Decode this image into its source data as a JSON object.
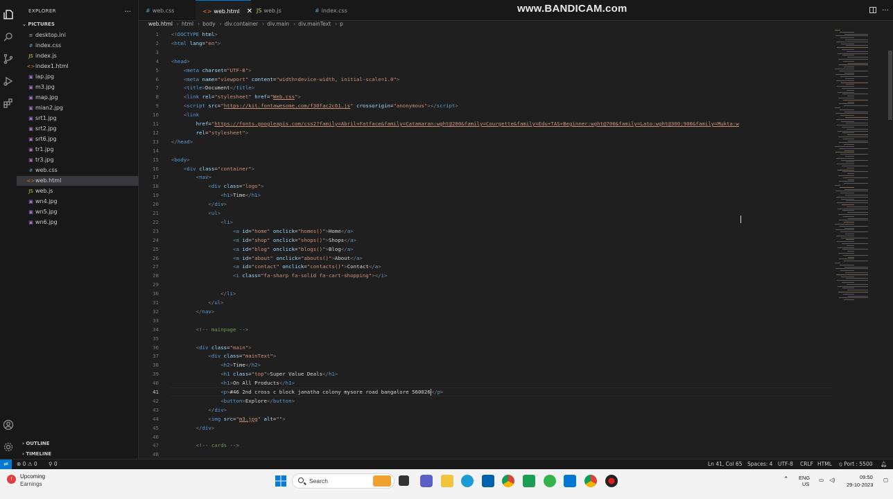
{
  "watermark": "www.BANDICAM.com",
  "sidebar": {
    "title": "EXPLORER",
    "more": "...",
    "folder": "PICTURES",
    "files": [
      {
        "name": "desktop.ini",
        "icon": "≡",
        "color": "#a0a0a0"
      },
      {
        "name": "index.css",
        "icon": "#",
        "color": "#519aba"
      },
      {
        "name": "index.js",
        "icon": "JS",
        "color": "#cbcb41"
      },
      {
        "name": "index1.html",
        "icon": "<>",
        "color": "#e37933"
      },
      {
        "name": "lap.jpg",
        "icon": "▣",
        "color": "#a074c4"
      },
      {
        "name": "m3.jpg",
        "icon": "▣",
        "color": "#a074c4"
      },
      {
        "name": "map.jpg",
        "icon": "▣",
        "color": "#a074c4"
      },
      {
        "name": "mian2.jpg",
        "icon": "▣",
        "color": "#a074c4"
      },
      {
        "name": "srt1.jpg",
        "icon": "▣",
        "color": "#a074c4"
      },
      {
        "name": "srt2.jpg",
        "icon": "▣",
        "color": "#a074c4"
      },
      {
        "name": "srt6.jpg",
        "icon": "▣",
        "color": "#a074c4"
      },
      {
        "name": "tr1.jpg",
        "icon": "▣",
        "color": "#a074c4"
      },
      {
        "name": "tr3.jpg",
        "icon": "▣",
        "color": "#a074c4"
      },
      {
        "name": "web.css",
        "icon": "#",
        "color": "#519aba"
      },
      {
        "name": "web.html",
        "icon": "<>",
        "color": "#e37933",
        "selected": true
      },
      {
        "name": "web.js",
        "icon": "JS",
        "color": "#cbcb41"
      },
      {
        "name": "wn4.jpg",
        "icon": "▣",
        "color": "#a074c4"
      },
      {
        "name": "wn5.jpg",
        "icon": "▣",
        "color": "#a074c4"
      },
      {
        "name": "wn6.jpg",
        "icon": "▣",
        "color": "#a074c4"
      }
    ],
    "outline": "OUTLINE",
    "timeline": "TIMELINE"
  },
  "tabs": [
    {
      "label": "web.css",
      "icon": "#",
      "color": "#519aba"
    },
    {
      "label": "web.html",
      "icon": "<>",
      "color": "#e37933",
      "active": true,
      "close": "✕"
    },
    {
      "label": "web.js",
      "icon": "JS",
      "color": "#cbcb41"
    },
    {
      "label": "index.css",
      "icon": "#",
      "color": "#519aba"
    },
    {
      "label": "index.css",
      "icon": "#",
      "color": "#519aba"
    }
  ],
  "breadcrumb": [
    "web.html",
    "html",
    "body",
    "div.container",
    "div.main",
    "div.mainText",
    "p"
  ],
  "code": [
    {
      "n": 1,
      "h": "<span class='t'>&lt;!</span><span class='tn'>DOCTYPE</span> <span class='at'>html</span><span class='t'>&gt;</span>"
    },
    {
      "n": 2,
      "h": "<span class='t'>&lt;</span><span class='tn'>html</span> <span class='at'>lang</span>=<span class='sv'>\"en\"</span><span class='t'>&gt;</span>"
    },
    {
      "n": 3,
      "h": ""
    },
    {
      "n": 4,
      "h": "<span class='t'>&lt;</span><span class='tn'>head</span><span class='t'>&gt;</span>"
    },
    {
      "n": 5,
      "h": "    <span class='t'>&lt;</span><span class='tn'>meta</span> <span class='at'>charset</span>=<span class='sv'>\"UTF-8\"</span><span class='t'>&gt;</span>"
    },
    {
      "n": 6,
      "h": "    <span class='t'>&lt;</span><span class='tn'>meta</span> <span class='at'>name</span>=<span class='sv'>\"viewport\"</span> <span class='at'>content</span>=<span class='sv'>\"width=device-width, initial-scale=1.0\"</span><span class='t'>&gt;</span>"
    },
    {
      "n": 7,
      "h": "    <span class='t'>&lt;</span><span class='tn'>title</span><span class='t'>&gt;</span>Document<span class='t'>&lt;/</span><span class='tn'>title</span><span class='t'>&gt;</span>"
    },
    {
      "n": 8,
      "h": "    <span class='t'>&lt;</span><span class='tn'>link</span> <span class='at'>rel</span>=<span class='sv'>\"stylesheet\"</span> <span class='at'>href</span>=<span class='sv'>\"<span class='ul'>Web.css</span>\"</span><span class='t'>&gt;</span>"
    },
    {
      "n": 9,
      "h": "    <span class='t'>&lt;</span><span class='tn'>script</span> <span class='at'>src</span>=<span class='sv'>\"<span class='ul'>https://kit.fontawesome.com/f30fac2c61.js</span>\"</span> <span class='at'>crossorigin</span>=<span class='sv'>\"anonymous\"</span><span class='t'>&gt;&lt;/</span><span class='tn'>script</span><span class='t'>&gt;</span>"
    },
    {
      "n": 10,
      "h": "    <span class='t'>&lt;</span><span class='tn'>link</span>"
    },
    {
      "n": 11,
      "h": "        <span class='at'>href</span>=<span class='sv'>\"<span class='ul'>https://fonts.googleapis.com/css2?family=Abril+Fatface&amp;family=Catamaran:wght@200&amp;family=Courgette&amp;family=Edu+TAS+Beginner:wght@700&amp;family=Lato:wght@300;900&amp;family=Mukta:w</span></span>"
    },
    {
      "n": 12,
      "h": "        <span class='at'>rel</span>=<span class='sv'>\"stylesheet\"</span><span class='t'>&gt;</span>"
    },
    {
      "n": 13,
      "h": "<span class='t'>&lt;/</span><span class='tn'>head</span><span class='t'>&gt;</span>"
    },
    {
      "n": 14,
      "h": ""
    },
    {
      "n": 15,
      "h": "<span class='t'>&lt;</span><span class='tn'>body</span><span class='t'>&gt;</span>"
    },
    {
      "n": 16,
      "h": "    <span class='t'>&lt;</span><span class='tn'>div</span> <span class='at'>class</span>=<span class='sv'>\"container\"</span><span class='t'>&gt;</span>"
    },
    {
      "n": 17,
      "h": "        <span class='t'>&lt;</span><span class='tn'>nav</span><span class='t'>&gt;</span>"
    },
    {
      "n": 18,
      "h": "            <span class='t'>&lt;</span><span class='tn'>div</span> <span class='at'>class</span>=<span class='sv'>\"logo\"</span><span class='t'>&gt;</span>"
    },
    {
      "n": 19,
      "h": "                <span class='t'>&lt;</span><span class='tn'>h1</span><span class='t'>&gt;</span>Time<span class='t'>&lt;/</span><span class='tn'>h1</span><span class='t'>&gt;</span>"
    },
    {
      "n": 20,
      "h": "            <span class='t'>&lt;/</span><span class='tn'>div</span><span class='t'>&gt;</span>"
    },
    {
      "n": 21,
      "h": "            <span class='t'>&lt;</span><span class='tn'>ul</span><span class='t'>&gt;</span>"
    },
    {
      "n": 22,
      "h": "                <span class='t'>&lt;</span><span class='tn'>li</span><span class='t'>&gt;</span>"
    },
    {
      "n": 23,
      "h": "                    <span class='t'>&lt;</span><span class='tn'>a</span> <span class='at'>id</span>=<span class='sv'>\"home\"</span> <span class='at'>onclick</span>=<span class='sv'>\"homes()\"</span><span class='t'>&gt;</span>Home<span class='t'>&lt;/</span><span class='tn'>a</span><span class='t'>&gt;</span>"
    },
    {
      "n": 24,
      "h": "                    <span class='t'>&lt;</span><span class='tn'>a</span> <span class='at'>id</span>=<span class='sv'>\"shop\"</span> <span class='at'>onclick</span>=<span class='sv'>\"shops()\"</span><span class='t'>&gt;</span>Shops<span class='t'>&lt;/</span><span class='tn'>a</span><span class='t'>&gt;</span>"
    },
    {
      "n": 25,
      "h": "                    <span class='t'>&lt;</span><span class='tn'>a</span> <span class='at'>id</span>=<span class='sv'>\"blog\"</span> <span class='at'>onclick</span>=<span class='sv'>\"blogs()\"</span><span class='t'>&gt;</span>Blog<span class='t'>&lt;/</span><span class='tn'>a</span><span class='t'>&gt;</span>"
    },
    {
      "n": 26,
      "h": "                    <span class='t'>&lt;</span><span class='tn'>a</span> <span class='at'>id</span>=<span class='sv'>\"about\"</span> <span class='at'>onclick</span>=<span class='sv'>\"abouts()\"</span><span class='t'>&gt;</span>About<span class='t'>&lt;/</span><span class='tn'>a</span><span class='t'>&gt;</span>"
    },
    {
      "n": 27,
      "h": "                    <span class='t'>&lt;</span><span class='tn'>a</span> <span class='at'>id</span>=<span class='sv'>\"contact\"</span> <span class='at'>onclick</span>=<span class='sv'>\"contacts()\"</span><span class='t'>&gt;</span>Contact<span class='t'>&lt;/</span><span class='tn'>a</span><span class='t'>&gt;</span>"
    },
    {
      "n": 28,
      "h": "                    <span class='t'>&lt;</span><span class='tn'>i</span> <span class='at'>class</span>=<span class='sv'>\"fa-sharp fa-solid fa-cart-shopping\"</span><span class='t'>&gt;&lt;/</span><span class='tn'>i</span><span class='t'>&gt;</span>"
    },
    {
      "n": 29,
      "h": ""
    },
    {
      "n": 30,
      "h": "                <span class='t'>&lt;/</span><span class='tn'>li</span><span class='t'>&gt;</span>"
    },
    {
      "n": 31,
      "h": "            <span class='t'>&lt;/</span><span class='tn'>ul</span><span class='t'>&gt;</span>"
    },
    {
      "n": 32,
      "h": "        <span class='t'>&lt;/</span><span class='tn'>nav</span><span class='t'>&gt;</span>"
    },
    {
      "n": 33,
      "h": ""
    },
    {
      "n": 34,
      "h": "        <span class='cm'>&lt;!-- mainpage --&gt;</span>"
    },
    {
      "n": 35,
      "h": ""
    },
    {
      "n": 36,
      "h": "        <span class='t'>&lt;</span><span class='tn'>div</span> <span class='at'>class</span>=<span class='sv'>\"main\"</span><span class='t'>&gt;</span>"
    },
    {
      "n": 37,
      "h": "            <span class='t'>&lt;</span><span class='tn'>div</span> <span class='at'>class</span>=<span class='sv'>\"mainText\"</span><span class='t'>&gt;</span>"
    },
    {
      "n": 38,
      "h": "                <span class='t'>&lt;</span><span class='tn'>h2</span><span class='t'>&gt;</span>Time<span class='t'>&lt;/</span><span class='tn'>h2</span><span class='t'>&gt;</span>"
    },
    {
      "n": 39,
      "h": "                <span class='t'>&lt;</span><span class='tn'>h1</span> <span class='at'>class</span>=<span class='sv'>\"top\"</span><span class='t'>&gt;</span>Super Value Deals<span class='t'>&lt;/</span><span class='tn'>h1</span><span class='t'>&gt;</span>"
    },
    {
      "n": 40,
      "h": "                <span class='t'>&lt;</span><span class='tn'>h1</span><span class='t'>&gt;</span>On All Products<span class='t'>&lt;/</span><span class='tn'>h1</span><span class='t'>&gt;</span>"
    },
    {
      "n": 41,
      "h": "                <span class='t'>&lt;</span><span class='tn'>p</span><span class='t'>&gt;</span>#46 2nd cross c block janatha colony mysore road bangalore 560026<span class='caret'></span><span class='t'>&lt;/</span><span class='tn'>p</span><span class='t'>&gt;</span>",
      "current": true
    },
    {
      "n": 42,
      "h": "                <span class='t'>&lt;</span><span class='tn'>button</span><span class='t'>&gt;</span>Explore<span class='t'>&lt;/</span><span class='tn'>button</span><span class='t'>&gt;</span>"
    },
    {
      "n": 43,
      "h": "            <span class='t'>&lt;/</span><span class='tn'>div</span><span class='t'>&gt;</span>"
    },
    {
      "n": 44,
      "h": "            <span class='t'>&lt;</span><span class='tn'>img</span> <span class='at'>src</span>=<span class='sv'>\"<span class='ul'>m3.jpg</span>\"</span> <span class='at'>alt</span>=<span class='sv'>\"\"</span><span class='t'>&gt;</span>"
    },
    {
      "n": 45,
      "h": "        <span class='t'>&lt;/</span><span class='tn'>div</span><span class='t'>&gt;</span>"
    },
    {
      "n": 46,
      "h": ""
    },
    {
      "n": 47,
      "h": "        <span class='cm'>&lt;!-- cards --&gt;</span>"
    },
    {
      "n": 48,
      "h": ""
    }
  ],
  "statusbar": {
    "problems": "⊗ 0 ⚠ 0",
    "ports": "⚲ 0",
    "position": "Ln 41, Col 65",
    "spaces": "Spaces: 4",
    "encoding": "UTF-8",
    "eol": "CRLF",
    "language": "HTML",
    "port": "⦸ Port : 5500"
  },
  "taskbar": {
    "weather_title": "Upcoming",
    "weather_sub": "Earnings",
    "search": "Search",
    "lang1": "ENG",
    "lang2": "US",
    "time": "09:50",
    "date": "29-10-2023"
  }
}
